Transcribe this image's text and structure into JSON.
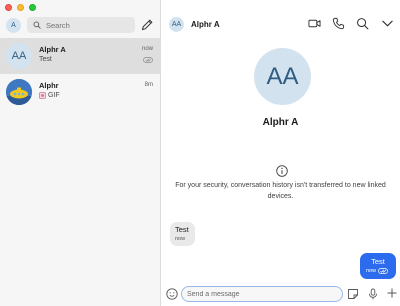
{
  "sidebar": {
    "me_avatar": "A",
    "search_placeholder": "Search",
    "conversations": [
      {
        "name": "Alphr A",
        "avatar": "AA",
        "snippet": "Test",
        "time": "now",
        "active": true
      },
      {
        "name": "Alphr",
        "avatar": "image",
        "snippet": "GIF",
        "time": "8m",
        "active": false
      }
    ]
  },
  "header": {
    "avatar": "AA",
    "name": "Alphr A",
    "icons": [
      "video-call-icon",
      "phone-call-icon",
      "search-icon",
      "chevron-down-icon"
    ]
  },
  "profile": {
    "avatar": "AA",
    "name": "Alphr A"
  },
  "notice": "For your security, conversation history isn't transferred to new linked devices.",
  "messages": [
    {
      "direction": "incoming",
      "text": "Test",
      "time": "now"
    },
    {
      "direction": "outgoing",
      "text": "Test",
      "time": "now"
    }
  ],
  "composer": {
    "placeholder": "Send a message"
  },
  "colors": {
    "accent": "#2c6bed",
    "avatar_bg": "#d2e3ef",
    "avatar_text": "#2f5d83"
  }
}
